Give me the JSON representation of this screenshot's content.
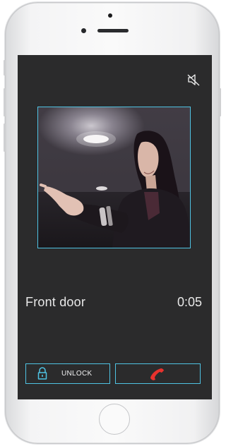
{
  "device": {
    "model": "smartphone",
    "screen_color": "#2b2b2c"
  },
  "call": {
    "caller_name": "Front door",
    "timer": "0:05"
  },
  "controls": {
    "mute_icon": "speaker-muted-icon",
    "unlock_label": "UNLOCK",
    "unlock_icon": "padlock-icon",
    "hangup_icon": "phone-hangup-icon"
  },
  "colors": {
    "accent": "#4fc3e3",
    "hangup": "#e8322d",
    "text": "#e9e9e9"
  }
}
